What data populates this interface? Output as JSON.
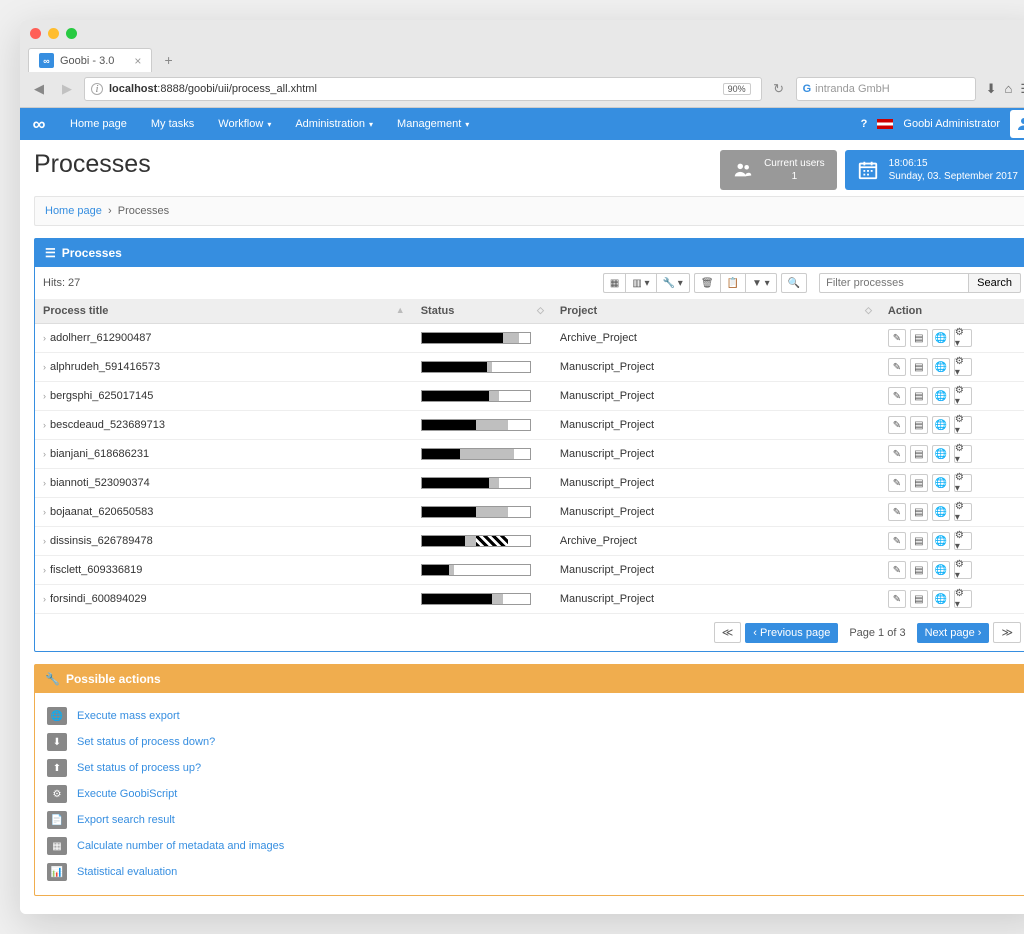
{
  "browser": {
    "tab_title": "Goobi - 3.0",
    "url_host": "localhost",
    "url_path": ":8888/goobi/uii/process_all.xhtml",
    "zoom": "90%",
    "search_placeholder": "intranda GmbH"
  },
  "nav": {
    "home": "Home page",
    "my_tasks": "My tasks",
    "workflow": "Workflow",
    "administration": "Administration",
    "management": "Management",
    "username": "Goobi Administrator"
  },
  "header": {
    "title": "Processes",
    "current_users_label": "Current users",
    "current_users_count": "1",
    "time": "18:06:15",
    "date": "Sunday, 03. September 2017"
  },
  "breadcrumb": {
    "home": "Home page",
    "current": "Processes"
  },
  "processes_panel": {
    "title": "Processes",
    "hits": "Hits: 27",
    "filter_placeholder": "Filter processes",
    "search_button": "Search",
    "columns": {
      "title": "Process title",
      "status": "Status",
      "project": "Project",
      "action": "Action"
    },
    "rows": [
      {
        "title": "adolherr_612900487",
        "project": "Archive_Project",
        "status": [
          75,
          15,
          10,
          0
        ]
      },
      {
        "title": "alphrudeh_591416573",
        "project": "Manuscript_Project",
        "status": [
          60,
          5,
          35,
          0
        ]
      },
      {
        "title": "bergsphi_625017145",
        "project": "Manuscript_Project",
        "status": [
          62,
          10,
          28,
          0
        ]
      },
      {
        "title": "bescdeaud_523689713",
        "project": "Manuscript_Project",
        "status": [
          50,
          30,
          20,
          0
        ]
      },
      {
        "title": "bianjani_618686231",
        "project": "Manuscript_Project",
        "status": [
          35,
          50,
          15,
          0
        ]
      },
      {
        "title": "biannoti_523090374",
        "project": "Manuscript_Project",
        "status": [
          62,
          10,
          28,
          0
        ]
      },
      {
        "title": "bojaanat_620650583",
        "project": "Manuscript_Project",
        "status": [
          50,
          30,
          20,
          0
        ]
      },
      {
        "title": "dissinsis_626789478",
        "project": "Archive_Project",
        "status": [
          40,
          10,
          20,
          30
        ]
      },
      {
        "title": "fisclett_609336819",
        "project": "Manuscript_Project",
        "status": [
          25,
          5,
          70,
          0
        ]
      },
      {
        "title": "forsindi_600894029",
        "project": "Manuscript_Project",
        "status": [
          65,
          10,
          25,
          0
        ]
      }
    ]
  },
  "pagination": {
    "prev": "Previous page",
    "label": "Page 1 of 3",
    "next": "Next page"
  },
  "possible_actions": {
    "title": "Possible actions",
    "items": [
      {
        "icon": "globe",
        "label": "Execute mass export"
      },
      {
        "icon": "arrow-down",
        "label": "Set status of process down?"
      },
      {
        "icon": "arrow-up",
        "label": "Set status of process up?"
      },
      {
        "icon": "cogs",
        "label": "Execute GoobiScript"
      },
      {
        "icon": "file",
        "label": "Export search result"
      },
      {
        "icon": "table",
        "label": "Calculate number of metadata and images"
      },
      {
        "icon": "chart",
        "label": "Statistical evaluation"
      }
    ]
  }
}
